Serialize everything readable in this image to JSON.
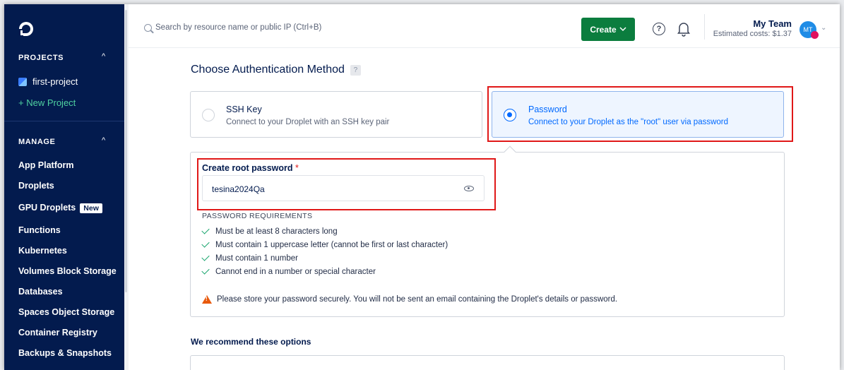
{
  "sidebar": {
    "projects_heading": "PROJECTS",
    "project_name": "first-project",
    "new_project": "+ New Project",
    "manage_heading": "MANAGE",
    "nav": [
      {
        "label": "App Platform"
      },
      {
        "label": "Droplets"
      },
      {
        "label": "GPU Droplets",
        "badge": "New"
      },
      {
        "label": "Functions"
      },
      {
        "label": "Kubernetes"
      },
      {
        "label": "Volumes Block Storage"
      },
      {
        "label": "Databases"
      },
      {
        "label": "Spaces Object Storage"
      },
      {
        "label": "Container Registry"
      },
      {
        "label": "Backups & Snapshots"
      }
    ]
  },
  "topbar": {
    "search_placeholder": "Search by resource name or public IP (Ctrl+B)",
    "create_label": "Create",
    "team_name": "My Team",
    "estimated_costs": "Estimated costs: $1.37",
    "avatar_initials": "MT"
  },
  "auth": {
    "title": "Choose Authentication Method",
    "help": "?",
    "options": [
      {
        "title": "SSH Key",
        "desc": "Connect to your Droplet with an SSH key pair",
        "selected": false
      },
      {
        "title": "Password",
        "desc": "Connect to your Droplet as the \"root\" user via password",
        "selected": true
      }
    ],
    "password_label": "Create root password",
    "required_mark": "*",
    "password_value": "tesina2024Qa",
    "requirements_heading": "PASSWORD REQUIREMENTS",
    "requirements": [
      "Must be at least 8 characters long",
      "Must contain 1 uppercase letter (cannot be first or last character)",
      "Must contain 1 number",
      "Cannot end in a number or special character"
    ],
    "warning": "Please store your password securely. You will not be sent an email containing the Droplet's details or password."
  },
  "recommend": {
    "title": "We recommend these options"
  },
  "colors": {
    "sidebar_bg": "#031b4e",
    "accent": "#0069ff",
    "create_button": "#0b7d3e",
    "highlight": "#e01818",
    "check": "#14a36a",
    "warning": "#e8590c"
  }
}
